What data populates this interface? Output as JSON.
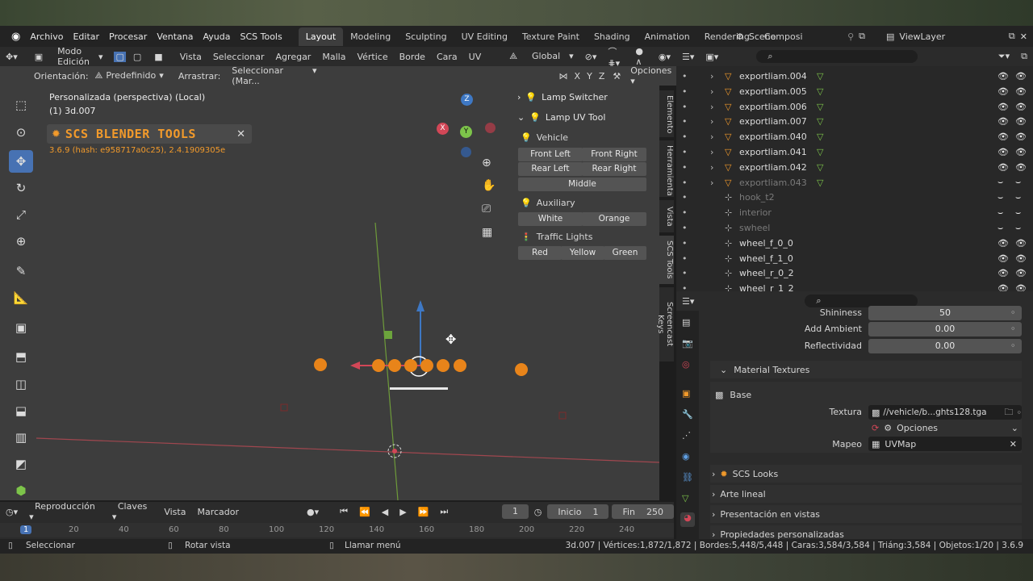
{
  "menu": {
    "items": [
      "Archivo",
      "Editar",
      "Procesar",
      "Ventana",
      "Ayuda",
      "SCS Tools"
    ]
  },
  "workspace_tabs": [
    "Layout",
    "Modeling",
    "Sculpting",
    "UV Editing",
    "Texture Paint",
    "Shading",
    "Animation",
    "Rendering",
    "Composi"
  ],
  "scene": {
    "label": "Scene"
  },
  "viewlayer": {
    "label": "ViewLayer"
  },
  "view_header": {
    "mode": "Modo Edición",
    "items": [
      "Vista",
      "Seleccionar",
      "Agregar",
      "Malla",
      "Vértice",
      "Borde",
      "Cara",
      "UV"
    ],
    "transform": "Global"
  },
  "tool_header": {
    "orientation_label": "Orientación:",
    "orientation_value": "Predefinido",
    "drag_label": "Arrastrar:",
    "drag_value": "Seleccionar (Mar...",
    "x": "X",
    "y": "Y",
    "z": "Z",
    "options": "Opciones"
  },
  "viewport": {
    "view_name": "Personalizada (perspectiva) (Local)",
    "object_name": "(1) 3d.007",
    "scs_title": "SCS BLENDER TOOLS",
    "scs_version": "3.6.9 (hash: e958717a0c25), 2.4.1909305e",
    "gizmo_x": "X",
    "gizmo_y": "Y",
    "gizmo_z": "Z"
  },
  "npanel": {
    "lamp_switcher": "Lamp Switcher",
    "lamp_uv_tool": "Lamp UV Tool",
    "vehicle": "Vehicle",
    "front_left": "Front Left",
    "front_right": "Front Right",
    "rear_left": "Rear Left",
    "rear_right": "Rear Right",
    "middle": "Middle",
    "auxiliary": "Auxiliary",
    "white": "White",
    "orange": "Orange",
    "traffic_lights": "Traffic Lights",
    "red": "Red",
    "yellow": "Yellow",
    "green": "Green"
  },
  "side_tabs": [
    "Elemento",
    "Herramienta",
    "Vista",
    "SCS Tools",
    "Screencast Keys"
  ],
  "outliner": {
    "rows": [
      {
        "name": "exportliam.004",
        "dim": false
      },
      {
        "name": "exportliam.005",
        "dim": false
      },
      {
        "name": "exportliam.006",
        "dim": false
      },
      {
        "name": "exportliam.007",
        "dim": false
      },
      {
        "name": "exportliam.040",
        "dim": false
      },
      {
        "name": "exportliam.041",
        "dim": false
      },
      {
        "name": "exportliam.042",
        "dim": false
      },
      {
        "name": "exportliam.043",
        "dim": true
      },
      {
        "name": "hook_t2",
        "dim": true
      },
      {
        "name": "interior",
        "dim": true
      },
      {
        "name": "swheel",
        "dim": true
      },
      {
        "name": "wheel_f_0_0",
        "dim": false
      },
      {
        "name": "wheel_f_1_0",
        "dim": false
      },
      {
        "name": "wheel_r_0_2",
        "dim": false
      },
      {
        "name": "wheel_r_1_2",
        "dim": false
      }
    ]
  },
  "properties": {
    "shininess_label": "Shininess",
    "shininess_value": "50",
    "add_ambient_label": "Add Ambient",
    "add_ambient_value": "0.00",
    "reflectivity_label": "Reflectividad",
    "reflectivity_value": "0.00",
    "material_textures": "Material Textures",
    "base": "Base",
    "texture_label": "Textura",
    "texture_value": "//vehicle/b...ghts128.tga",
    "options": "Opciones",
    "mapping_label": "Mapeo",
    "mapping_value": "UVMap",
    "scs_looks": "SCS Looks",
    "line_art": "Arte lineal",
    "viewport_display": "Presentación en vistas",
    "custom_props": "Propiedades personalizadas"
  },
  "timeline": {
    "playback": "Reproducción",
    "keys": "Claves",
    "view": "Vista",
    "marker": "Marcador",
    "current_frame": "1",
    "start_label": "Inicio",
    "start": "1",
    "end_label": "Fin",
    "end": "250",
    "ruler": [
      "1",
      "20",
      "40",
      "60",
      "80",
      "100",
      "120",
      "140",
      "160",
      "180",
      "200",
      "220",
      "240"
    ]
  },
  "status": {
    "select": "Seleccionar",
    "rotate": "Rotar vista",
    "menu": "Llamar menú",
    "stats": "3d.007 | Vértices:1,872/1,872 | Bordes:5,448/5,448 | Caras:3,584/3,584 | Triáng:3,584 | Objetos:1/20 | 3.6.9"
  },
  "colors": {
    "accent": "#4772b3",
    "scs_orange": "#f29a2b",
    "light_dot": "#e8841a",
    "vertex_green": "#7dc44a"
  }
}
